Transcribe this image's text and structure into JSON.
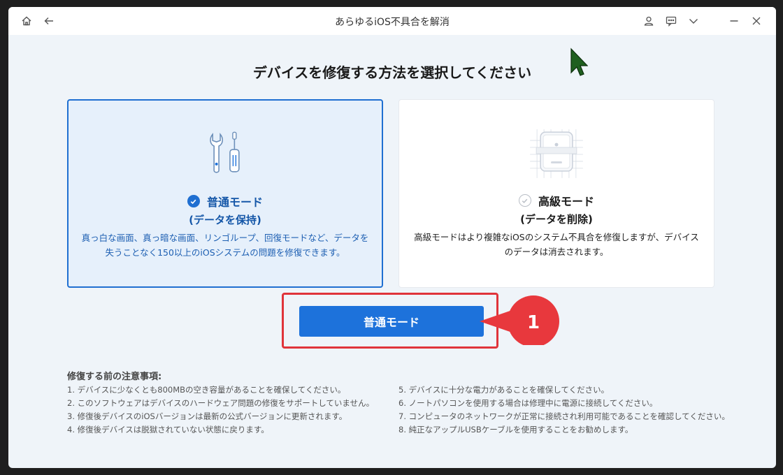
{
  "window": {
    "title": "あらゆるiOS不具合を解消"
  },
  "titlebar_icons": [
    "home-icon",
    "back-icon",
    "user-icon",
    "feedback-icon",
    "chevron-down-icon",
    "minimize-icon",
    "close-icon"
  ],
  "heading": "デバイスを修復する方法を選択してください",
  "modes": {
    "standard": {
      "title": "普通モード",
      "subtitle": "(データを保持)",
      "description": "真っ白な画面、真っ暗な画面、リンゴループ、回復モードなど、データを失うことなく150以上のiOSシステムの問題を修復できます。",
      "selected": true
    },
    "advanced": {
      "title": "高級モード",
      "subtitle": "(データを削除)",
      "description": "高級モードはより複雑なiOSのシステム不具合を修復しますが、デバイスのデータは消去されます。",
      "selected": false
    }
  },
  "primary_button": "普通モード",
  "callout_number": "1",
  "notes": {
    "title": "修復する前の注意事項:",
    "left": [
      "1.  デバイスに少なくとも800MBの空き容量があることを確保してください。",
      "2.  このソフトウェアはデバイスのハードウェア問題の修復をサポートしていません。",
      "3.  修復後デバイスのiOSバージョンは最新の公式バージョンに更新されます。",
      "4.  修復後デバイスは脱獄されていない状態に戻ります。"
    ],
    "right": [
      "5.  デバイスに十分な電力があることを確保してください。",
      "6.  ノートパソコンを使用する場合は修理中に電源に接続してください。",
      "7.  コンピュータのネットワークが正常に接続され利用可能であることを確認してください。",
      "8.  純正なアップルUSBケーブルを使用することをお勧めします。"
    ]
  },
  "colors": {
    "accent": "#1d72db",
    "selected_border": "#1f6fd1",
    "highlight_red": "#e0343a",
    "background": "#eff4f9"
  }
}
